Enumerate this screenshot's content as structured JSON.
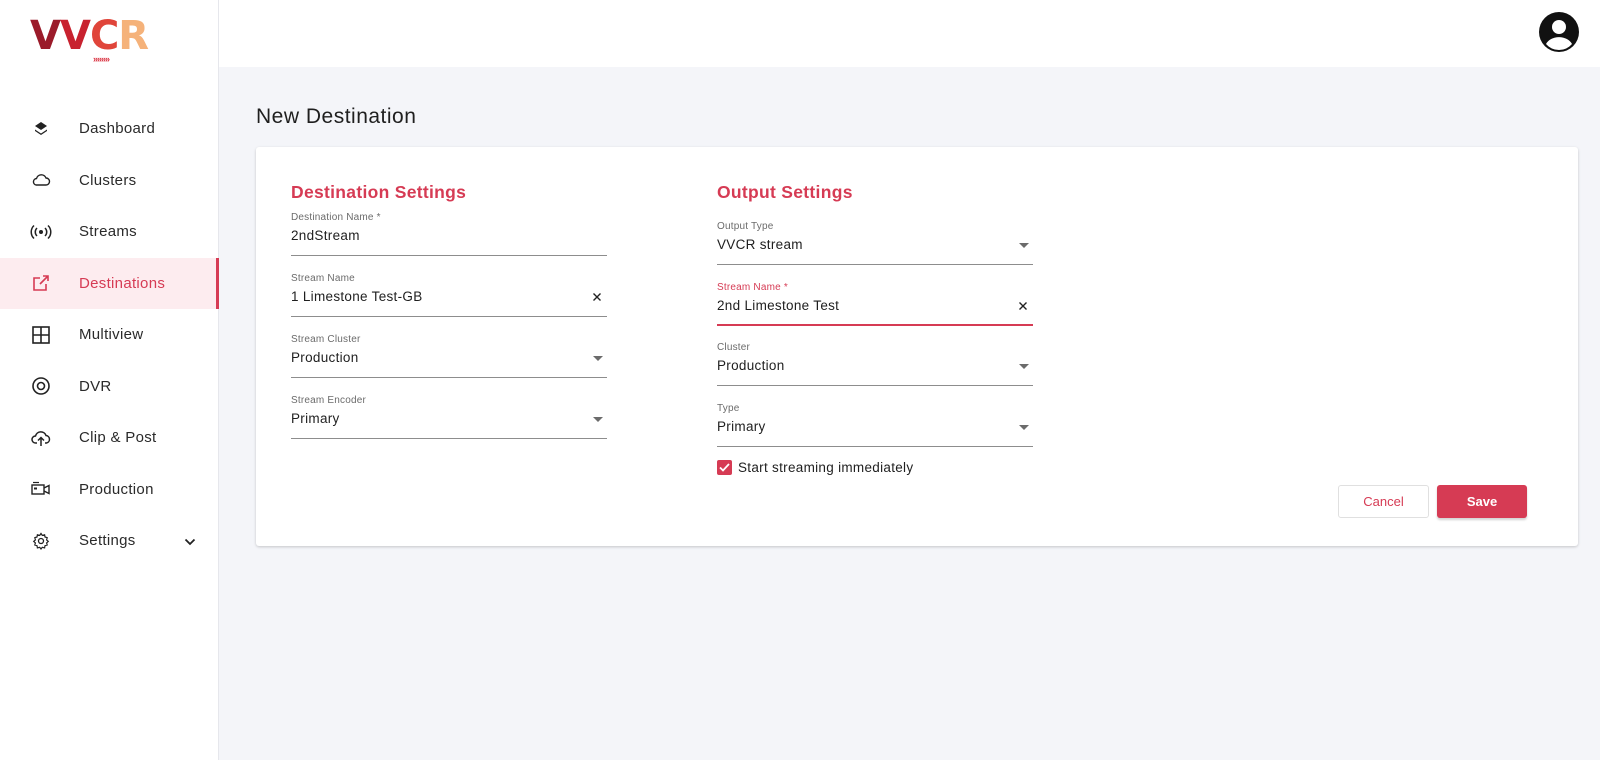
{
  "brand": {
    "logo_text": "VVCR",
    "logo_arrows": "››››››››"
  },
  "sidebar": {
    "items": [
      {
        "label": "Dashboard",
        "icon": "layers-icon"
      },
      {
        "label": "Clusters",
        "icon": "cloud-icon"
      },
      {
        "label": "Streams",
        "icon": "broadcast-icon"
      },
      {
        "label": "Destinations",
        "icon": "external-link-icon",
        "active": true
      },
      {
        "label": "Multiview",
        "icon": "grid-icon"
      },
      {
        "label": "DVR",
        "icon": "record-icon"
      },
      {
        "label": "Clip & Post",
        "icon": "cloud-upload-icon"
      },
      {
        "label": "Production",
        "icon": "video-camera-icon"
      },
      {
        "label": "Settings",
        "icon": "gear-icon",
        "expandable": true
      }
    ]
  },
  "page": {
    "title": "New Destination"
  },
  "destination_settings": {
    "title": "Destination Settings",
    "destination_name": {
      "label": "Destination Name *",
      "value": "2ndStream"
    },
    "stream_name": {
      "label": "Stream Name",
      "value": "1 Limestone Test-GB"
    },
    "stream_cluster": {
      "label": "Stream Cluster",
      "value": "Production"
    },
    "stream_encoder": {
      "label": "Stream Encoder",
      "value": "Primary"
    }
  },
  "output_settings": {
    "title": "Output Settings",
    "output_type": {
      "label": "Output Type",
      "value": "VVCR stream"
    },
    "stream_name": {
      "label": "Stream Name *",
      "value": "2nd Limestone Test"
    },
    "cluster": {
      "label": "Cluster",
      "value": "Production"
    },
    "type": {
      "label": "Type",
      "value": "Primary"
    },
    "start_streaming": {
      "label": "Start streaming immediately",
      "checked": true
    }
  },
  "actions": {
    "cancel": "Cancel",
    "save": "Save"
  },
  "colors": {
    "accent": "#d63b54",
    "background": "#f4f5f9"
  }
}
